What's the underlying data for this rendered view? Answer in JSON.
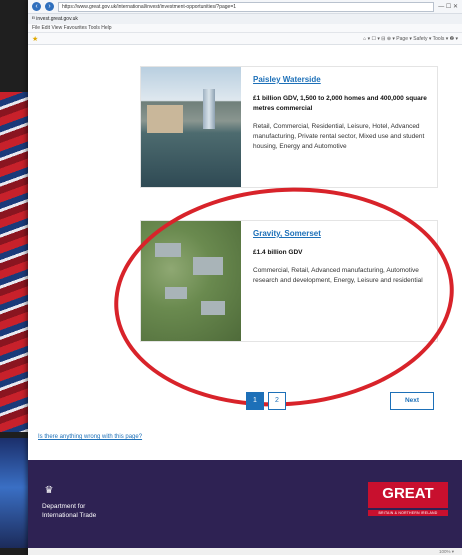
{
  "browser": {
    "address": "https://www.great.gov.uk/international/invest/investment-opportunities/?page=1",
    "tab_title": "ᴱᴵ invest.great.gov.uk",
    "menu": "File  Edit  View  Favourites  Tools  Help",
    "tools": "⌂ ▾ ☐ ▾ ⊟ ⊕ ▾ Page ▾ Safety ▾ Tools ▾ ❷ ▾",
    "window_controls": "— ☐ ✕",
    "status_text": "100% ▾"
  },
  "cards": [
    {
      "title": "Paisley Waterside",
      "stat": "£1 billion GDV, 1,500 to 2,000 homes and 400,000 square metres commercial",
      "desc": "Retail, Commercial, Residential, Leisure, Hotel, Advanced manufacturing, Private rental sector, Mixed use and student housing, Energy and Automotive"
    },
    {
      "title": "Gravity, Somerset",
      "stat": "£1.4 billion GDV",
      "desc": "Commercial, Retail, Advanced manufacturing, Automotive research and development, Energy, Leisure and residential"
    }
  ],
  "pagination": {
    "pages": [
      "1",
      "2"
    ],
    "active_page": "1",
    "next_label": "Next"
  },
  "problem_link": "Is there anything wrong with this page?",
  "footer": {
    "dept_line1": "Department for",
    "dept_line2": "International Trade",
    "great_logo": "GREAT",
    "great_sub": "BRITAIN & NORTHERN IRELAND"
  }
}
